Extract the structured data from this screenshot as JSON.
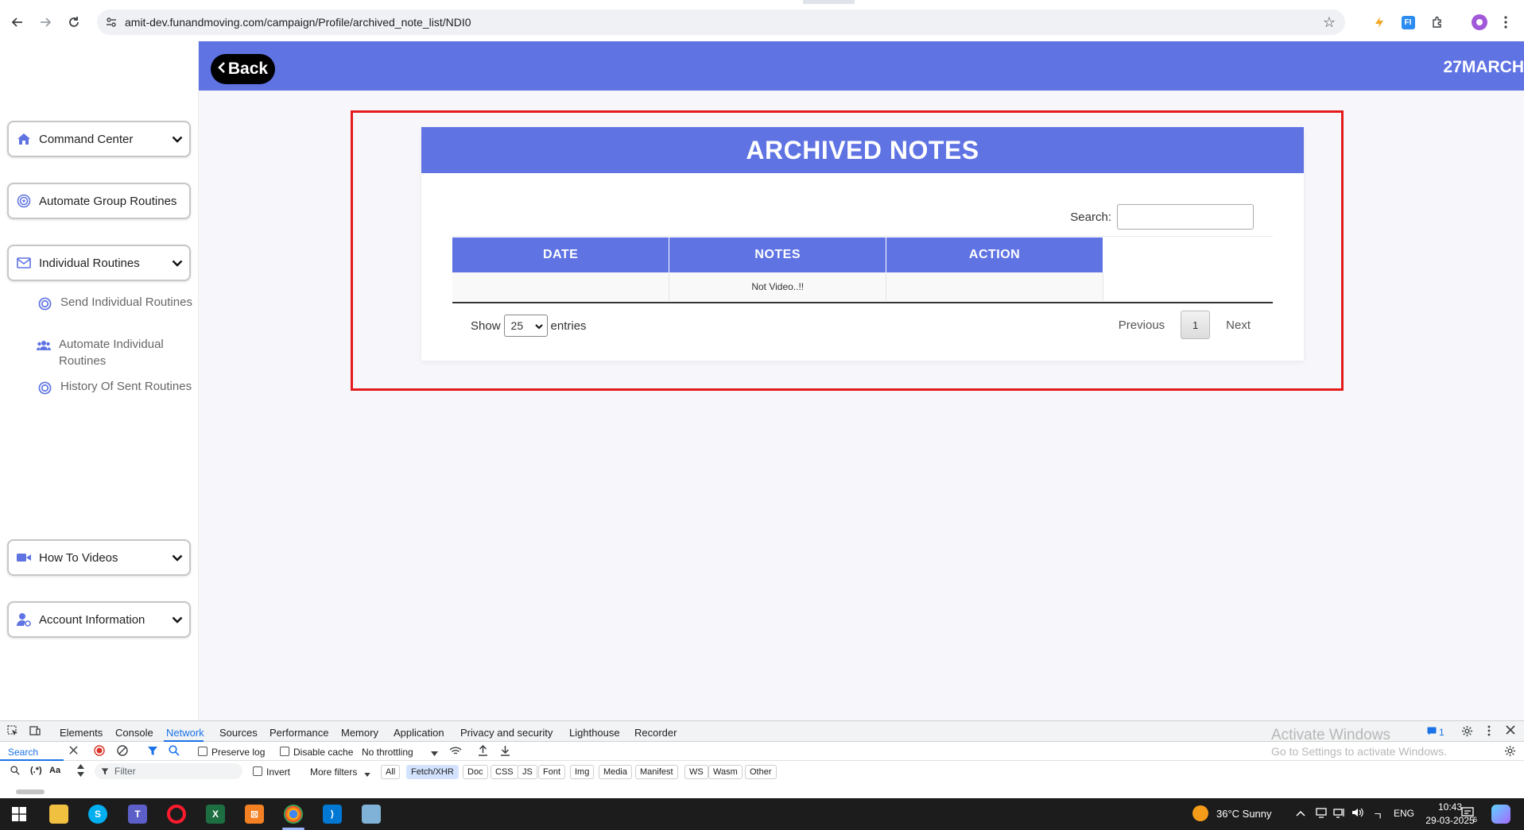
{
  "browser": {
    "url": "amit-dev.funandmoving.com/campaign/Profile/archived_note_list/NDI0"
  },
  "header": {
    "back_label": "Back",
    "title": "27MARCH",
    "color": "#5f73e3"
  },
  "sidebar": {
    "command_center": "Command Center",
    "automate_group_routines": "Automate Group Routines",
    "individual_routines": "Individual Routines",
    "sub_items": [
      {
        "label": "Send Individual Routines",
        "icon": "target-icon"
      },
      {
        "label": "Automate Individual Routines",
        "icon": "users-icon"
      },
      {
        "label": "History Of Sent Routines",
        "icon": "target-icon"
      }
    ],
    "how_to_videos": "How To Videos",
    "account_information": "Account Information"
  },
  "card": {
    "title": "ARCHIVED NOTES",
    "search_label": "Search:",
    "columns": [
      "DATE",
      "NOTES",
      "ACTION"
    ],
    "rows": [
      {
        "date": "",
        "notes": "Not Video..!!",
        "action": ""
      }
    ],
    "show_label": "Show",
    "entries_value": "25",
    "entries_label": "entries",
    "previous_label": "Previous",
    "page": "1",
    "next_label": "Next"
  },
  "devtools": {
    "tabs": [
      "Elements",
      "Console",
      "Network",
      "Sources",
      "Performance",
      "Memory",
      "Application",
      "Privacy and security",
      "Lighthouse",
      "Recorder"
    ],
    "active_tab": "Network",
    "search_label": "Search",
    "preserve_log": "Preserve log",
    "disable_cache": "Disable cache",
    "throttling": "No throttling",
    "filter_placeholder": "Filter",
    "invert": "Invert",
    "more_filters": "More filters",
    "filters": [
      "All",
      "Fetch/XHR",
      "Doc",
      "CSS",
      "JS",
      "Font",
      "Img",
      "Media",
      "Manifest",
      "WS",
      "Wasm",
      "Other"
    ],
    "active_filter": "Fetch/XHR",
    "case_label": "Aa",
    "regex_label": "(.*)",
    "issues_count": "1",
    "watermark_title": "Activate Windows",
    "watermark_sub": "Go to Settings to activate Windows."
  },
  "taskbar": {
    "weather": "36°C  Sunny",
    "language": "ENG",
    "time": "10:43",
    "date": "29-03-2025",
    "notif_count": "6"
  }
}
